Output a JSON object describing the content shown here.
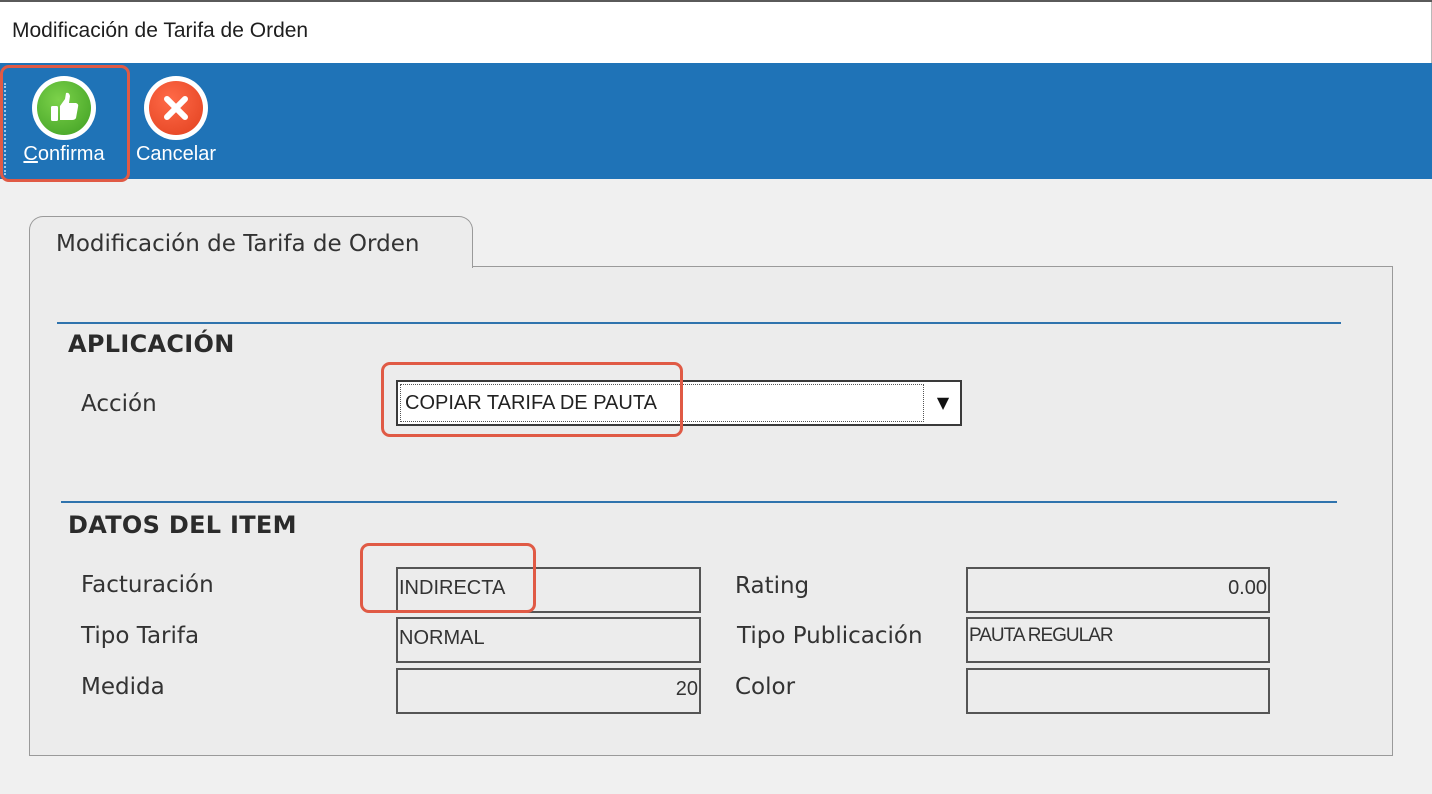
{
  "window": {
    "title": "Modificación de Tarifa de Orden"
  },
  "toolbar": {
    "confirm": {
      "label": "Confirma",
      "icon": "thumbs-up-icon"
    },
    "cancel": {
      "label": "Cancelar",
      "icon": "close-icon"
    }
  },
  "tab": {
    "label": "Modificación de Tarifa de Orden"
  },
  "aplicacion": {
    "heading": "APLICACIÓN",
    "accion_label": "Acción",
    "accion_value": "COPIAR TARIFA DE PAUTA",
    "dropdown_icon": "chevron-down-icon"
  },
  "datos": {
    "heading": "DATOS DEL ITEM",
    "facturacion_label": "Facturación",
    "facturacion_value": "INDIRECTA",
    "tipo_tarifa_label": "Tipo Tarifa",
    "tipo_tarifa_value": "NORMAL",
    "medida_label": "Medida",
    "medida_value": "20",
    "rating_label": "Rating",
    "rating_value": "0.00",
    "tipo_publicacion_label": "Tipo Publicación",
    "tipo_publicacion_value": "PAUTA REGULAR",
    "color_label": "Color",
    "color_value": ""
  },
  "colors": {
    "toolbar_bg": "#1f73b7",
    "highlight": "#e05a45",
    "divider": "#2f73ad"
  }
}
